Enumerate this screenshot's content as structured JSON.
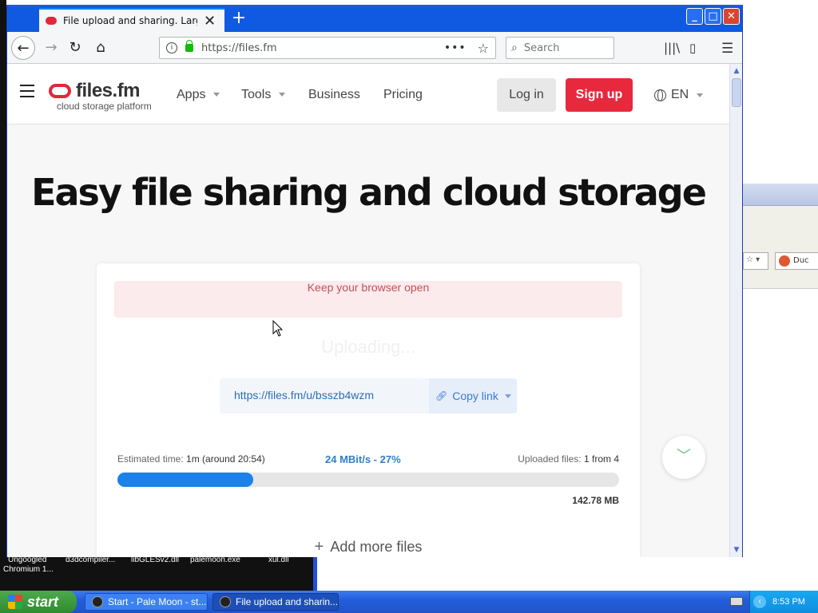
{
  "desktop": {
    "labels": [
      "Ungoogled",
      "d3dcompiler...",
      "libGLESv2.dll",
      "palemoon.exe",
      "xul.dll"
    ],
    "chromium_label": "Chromium 1..."
  },
  "browser": {
    "tab_title": "File upload and sharing. Large file",
    "url": "https://files.fm",
    "search_placeholder": "Search"
  },
  "site": {
    "logo_name": "files.fm",
    "logo_tagline": "cloud storage platform",
    "nav": {
      "apps": "Apps",
      "tools": "Tools",
      "business": "Business",
      "pricing": "Pricing"
    },
    "login": "Log in",
    "signup": "Sign up",
    "language": "EN",
    "headline": "Easy file sharing and cloud storage"
  },
  "upload": {
    "alert": "Keep your browser open",
    "status": "Uploading...",
    "share_link": "https://files.fm/u/bsszb4wzm",
    "copy_label": "Copy link",
    "est_label": "Estimated time:",
    "est_value": "1m (around 20:54)",
    "speed": "24 MBit/s - 27%",
    "files_label": "Uploaded files:",
    "files_value": "1 from 4",
    "progress_percent": 27,
    "total_size": "142.78 MB",
    "add_more": "Add more files"
  },
  "taskbar": {
    "start": "start",
    "task1": "Start - Pale Moon - st...",
    "task2": "File upload and sharin...",
    "clock": "8:53 PM"
  },
  "bg_window": {
    "search_text": "Duc"
  }
}
